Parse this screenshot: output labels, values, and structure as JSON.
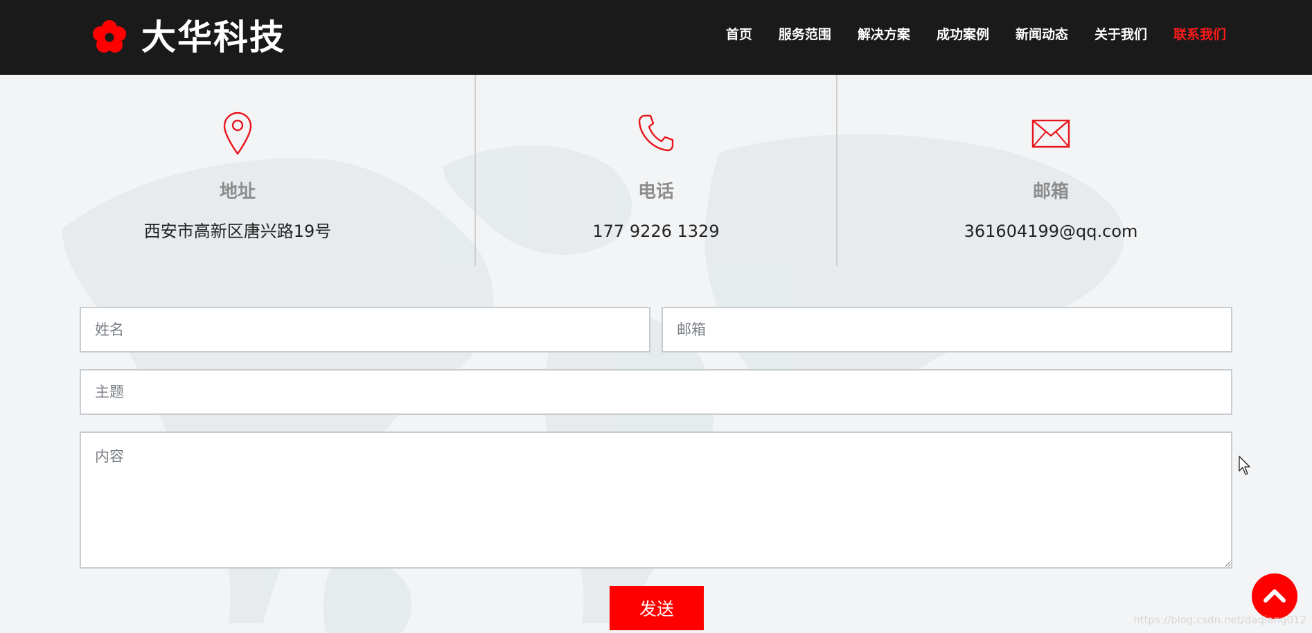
{
  "brand": {
    "name": "大华科技",
    "accent_color": "#ff0000",
    "header_bg": "#1a1a1a"
  },
  "nav": {
    "items": [
      {
        "label": "首页"
      },
      {
        "label": "服务范围"
      },
      {
        "label": "解决方案"
      },
      {
        "label": "成功案例"
      },
      {
        "label": "新闻动态"
      },
      {
        "label": "关于我们"
      },
      {
        "label": "联系我们"
      }
    ],
    "active_index": 6
  },
  "contact": {
    "address": {
      "icon": "map-pin-icon",
      "title": "地址",
      "value": "西安市高新区唐兴路19号"
    },
    "phone": {
      "icon": "phone-icon",
      "title": "电话",
      "value": "177 9226 1329"
    },
    "email": {
      "icon": "envelope-icon",
      "title": "邮箱",
      "value": "361604199@qq.com"
    }
  },
  "form": {
    "name_placeholder": "姓名",
    "email_placeholder": "邮箱",
    "subject_placeholder": "主题",
    "content_placeholder": "内容",
    "submit_label": "发送"
  },
  "back_to_top": {
    "icon": "chevron-up-icon"
  },
  "watermark": "https://blog.csdn.net/daqiang012"
}
